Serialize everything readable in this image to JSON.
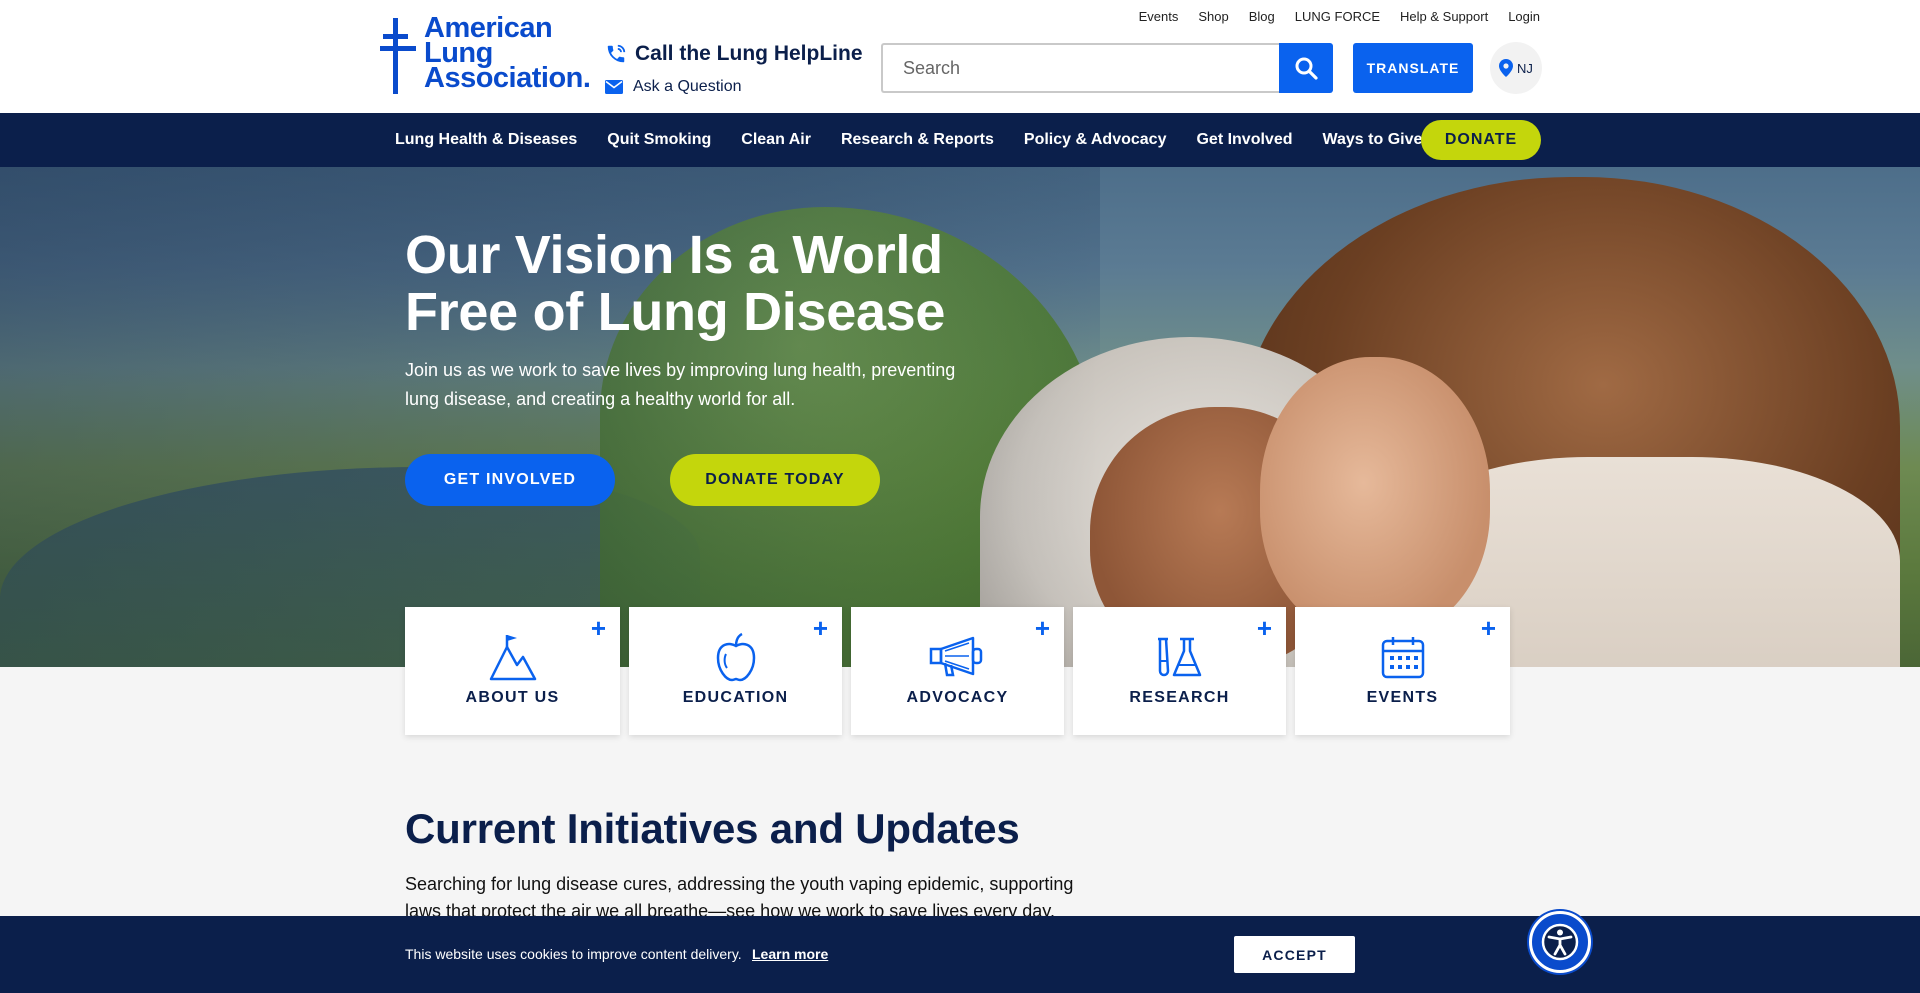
{
  "utility_nav": [
    "Events",
    "Shop",
    "Blog",
    "LUNG FORCE",
    "Help & Support",
    "Login"
  ],
  "logo": {
    "line1": "American",
    "line2": "Lung",
    "line3": "Association."
  },
  "helpline": {
    "call_label": "Call the Lung HelpLine",
    "ask_label": "Ask a Question"
  },
  "search": {
    "placeholder": "Search"
  },
  "translate_label": "TRANSLATE",
  "state_label": "NJ",
  "main_nav": [
    "Lung Health & Diseases",
    "Quit Smoking",
    "Clean Air",
    "Research & Reports",
    "Policy & Advocacy",
    "Get Involved",
    "Ways to Give"
  ],
  "donate_nav_label": "DONATE",
  "hero": {
    "title_line1": "Our Vision Is a World",
    "title_line2": "Free of Lung Disease",
    "subtitle": "Join us as we work to save lives by improving lung health, preventing lung disease, and creating a healthy world for all.",
    "cta_primary": "GET INVOLVED",
    "cta_secondary": "DONATE TODAY"
  },
  "cards": [
    {
      "label": "ABOUT US",
      "icon": "mountain-flag-icon"
    },
    {
      "label": "EDUCATION",
      "icon": "apple-icon"
    },
    {
      "label": "ADVOCACY",
      "icon": "megaphone-icon"
    },
    {
      "label": "RESEARCH",
      "icon": "flask-icon"
    },
    {
      "label": "EVENTS",
      "icon": "calendar-icon"
    }
  ],
  "initiatives": {
    "title": "Current Initiatives and Updates",
    "text": "Searching for lung disease cures, addressing the youth vaping epidemic, supporting laws that protect the air we all breathe—see how we work to save lives every day."
  },
  "cookie": {
    "text": "This website uses cookies to improve content delivery.",
    "link": "Learn more",
    "accept": "ACCEPT"
  },
  "colors": {
    "navy": "#0b1f4b",
    "blue": "#0a62ee",
    "lime": "#c4d60c",
    "logo_blue": "#0a4bcc"
  }
}
